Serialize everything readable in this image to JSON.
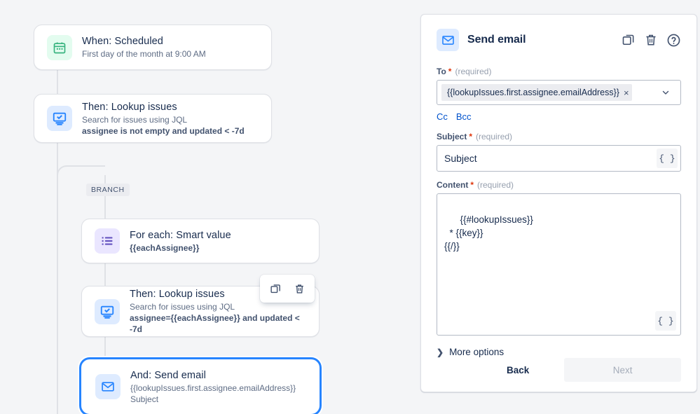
{
  "canvas": {
    "branch_pill_label": "BRANCH",
    "nodes": [
      {
        "title": "When: Scheduled",
        "sub1": "First day of the month at 9:00 AM",
        "sub2": "",
        "icon": "calendar-icon",
        "icon_bg": "#e3fcef",
        "icon_color": "#36b37e"
      },
      {
        "title": "Then: Lookup issues",
        "sub1": "Search for issues using JQL",
        "sub2": "assignee is not empty and updated < -7d",
        "icon": "monitor-check-icon",
        "icon_bg": "#deebff",
        "icon_color": "#2684ff"
      },
      {
        "title": "For each: Smart value",
        "sub1": "{{eachAssignee}}",
        "sub2": "",
        "icon": "list-icon",
        "icon_bg": "#eae6ff",
        "icon_color": "#6554c0"
      },
      {
        "title": "Then: Lookup issues",
        "sub1": "Search for issues using JQL",
        "sub2": "assignee={{eachAssignee}} and updated < -7d",
        "icon": "monitor-check-icon",
        "icon_bg": "#deebff",
        "icon_color": "#2684ff"
      },
      {
        "title": "And: Send email",
        "sub1": "{{lookupIssues.first.assignee.emailAddress}}",
        "sub2": "Subject",
        "icon": "envelope-icon",
        "icon_bg": "#deebff",
        "icon_color": "#2684ff"
      }
    ],
    "hover_toolbar": {
      "duplicate_label": "Duplicate",
      "delete_label": "Delete"
    }
  },
  "panel": {
    "title": "Send email",
    "icon": "envelope-icon",
    "actions": {
      "duplicate_label": "Duplicate",
      "delete_label": "Delete",
      "help_label": "Help"
    },
    "to": {
      "label": "To",
      "required_marker": "*",
      "required_text": "(required)",
      "chip_value": "{{lookupIssues.first.assignee.emailAddress}}",
      "chip_remove": "×"
    },
    "cc_label": "Cc",
    "bcc_label": "Bcc",
    "subject": {
      "label": "Subject",
      "required_marker": "*",
      "required_text": "(required)",
      "value": "Subject",
      "smart_value_button": "{ }"
    },
    "content": {
      "label": "Content",
      "required_marker": "*",
      "required_text": "(required)",
      "value": "{{#lookupIssues}}\n  * {{key}}\n{{/}}",
      "smart_value_button": "{ }"
    },
    "more_options_label": "More options",
    "back_label": "Back",
    "next_label": "Next"
  },
  "colors": {
    "page_bg": "#f4f5f7",
    "accent": "#0052cc",
    "selection": "#2684ff",
    "required": "#de350b",
    "connector": "#dfe1e6"
  }
}
